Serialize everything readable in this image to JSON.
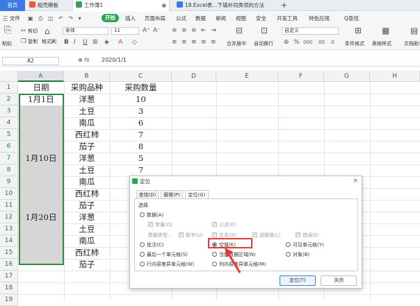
{
  "tabs": {
    "home": "首页",
    "t1": "稻壳模板",
    "t2": "工作簿1",
    "t3": "18.Excel表...下填补同类项的方法",
    "add": "+"
  },
  "menubar": {
    "file": "三 文件",
    "start": "开始",
    "items": [
      "插入",
      "页面布局",
      "公式",
      "数据",
      "审阅",
      "视图",
      "安全",
      "开发工具",
      "特色应用"
    ],
    "search": "Q查找"
  },
  "ribbon": {
    "paste": "粘贴",
    "cut": "剪切",
    "copy": "复制",
    "format_painter": "格式刷",
    "font": "宋体",
    "size": "11",
    "merge": "合并居中",
    "wrap": "自动换行",
    "numformat": "自定义",
    "cond": "条件格式",
    "table_style": "表格样式",
    "doc_assist": "文档助手"
  },
  "formula": {
    "cell": "A2",
    "fx": "fx",
    "value": "2020/1/1"
  },
  "columns": [
    "A",
    "B",
    "C",
    "D",
    "E",
    "F",
    "G",
    "H"
  ],
  "rows": [
    "1",
    "2",
    "3",
    "4",
    "5",
    "6",
    "7",
    "8",
    "9",
    "10",
    "11",
    "12",
    "13",
    "14",
    "15",
    "16",
    "17",
    "18",
    "19"
  ],
  "sheet": {
    "a": {
      "r1": "日期",
      "r2": "1月1日",
      "r7": "1月10日",
      "r12": "1月20日"
    },
    "b": [
      "采购品种",
      "洋葱",
      "土豆",
      "南瓜",
      "西红柿",
      "茄子",
      "洋葱",
      "土豆",
      "南瓜",
      "西红柿",
      "茄子",
      "洋葱",
      "土豆",
      "南瓜",
      "西红柿",
      "茄子"
    ],
    "c": [
      "采购数量",
      "10",
      "3",
      "6",
      "7",
      "8",
      "5",
      "7"
    ]
  },
  "dialog": {
    "title": "定位",
    "close": "×",
    "tabs": [
      "查找(D)",
      "替换(P)",
      "定位(G)"
    ],
    "group": "选择",
    "data": "数据(A)",
    "constant": "常量(O)",
    "formula": "公式(R)",
    "data_type": "数据类型:",
    "number": "数字(U)",
    "text": "文本(X)",
    "logical": "逻辑值(L)",
    "error": "错误(E)",
    "comment": "批注(C)",
    "blank": "空值(K)",
    "visible": "可见单元格(Y)",
    "last_cell": "最后一个单元格(S)",
    "current_region": "当前数据区域(N)",
    "object": "对象(B)",
    "row_diff": "行内容差异单元格(W)",
    "col_diff": "列内容差异单元格(M)",
    "ok": "定位(T)",
    "cancel": "关闭"
  },
  "colors": {
    "accent": "#2da44e",
    "selection": "#1e7a36",
    "highlight": "#e53935"
  }
}
